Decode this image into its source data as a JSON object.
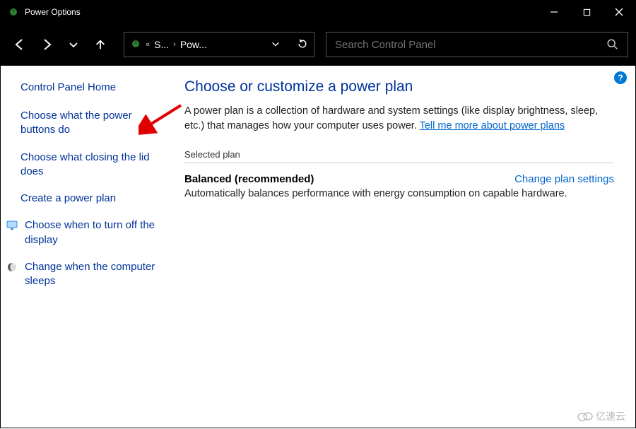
{
  "window": {
    "title": "Power Options"
  },
  "address": {
    "crumb1": "S...",
    "crumb2": "Pow..."
  },
  "search": {
    "placeholder": "Search Control Panel"
  },
  "sidebar": {
    "home": "Control Panel Home",
    "links": [
      {
        "label": "Choose what the power buttons do",
        "icon": null
      },
      {
        "label": "Choose what closing the lid does",
        "icon": null
      },
      {
        "label": "Create a power plan",
        "icon": null
      },
      {
        "label": "Choose when to turn off the display",
        "icon": "monitor"
      },
      {
        "label": "Change when the computer sleeps",
        "icon": "moon"
      }
    ]
  },
  "main": {
    "heading": "Choose or customize a power plan",
    "description_pre": "A power plan is a collection of hardware and system settings (like display brightness, sleep, etc.) that manages how your computer uses power. ",
    "description_link": "Tell me more about power plans",
    "section_label": "Selected plan",
    "plan_name": "Balanced (recommended)",
    "change_link": "Change plan settings",
    "plan_desc": "Automatically balances performance with energy consumption on capable hardware."
  },
  "help_badge": "?",
  "watermark": "亿速云"
}
